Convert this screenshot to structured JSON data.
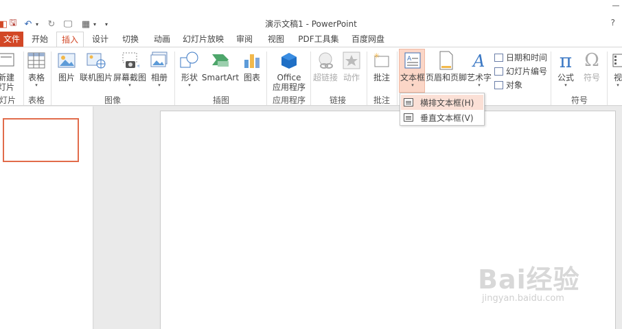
{
  "window": {
    "title": "演示文稿1 - PowerPoint",
    "help": "?"
  },
  "quick_access": {
    "save_icon": "save-icon",
    "undo_icon": "undo-icon",
    "undo_arrow": "▾",
    "redo_icon": "redo-icon",
    "customize_arrow": "▾"
  },
  "tabs": [
    "文件",
    "开始",
    "插入",
    "设计",
    "切换",
    "动画",
    "幻灯片放映",
    "审阅",
    "视图",
    "PDF工具集",
    "百度网盘"
  ],
  "active_tab": "插入",
  "ribbon": {
    "new_slide": {
      "line1": "新建",
      "line2": "灯片"
    },
    "table": "表格",
    "picture": "图片",
    "online_picture": "联机图片",
    "screenshot": "屏幕截图",
    "album": "相册",
    "shapes": "形状",
    "smartart": "SmartArt",
    "chart": "图表",
    "office_apps": {
      "line1": "Office",
      "line2": "应用程序"
    },
    "hyperlink": "超链接",
    "action": "动作",
    "comment": "批注",
    "textbox": "文本框",
    "header_footer": "页眉和页脚",
    "wordart": "艺术字",
    "date_time": "日期和时间",
    "slide_number": "幻灯片编号",
    "object": "对象",
    "equation": "公式",
    "symbol": "符号",
    "video": "视",
    "arrow": "▾"
  },
  "groups": {
    "slides": "灯片",
    "tables": "表格",
    "images": "图像",
    "illustrations": "插图",
    "apps": "应用程序",
    "links": "链接",
    "comments": "批注",
    "symbols": "符号"
  },
  "dropdown": {
    "horizontal": "横排文本框(H)",
    "vertical": "垂直文本框(V)"
  },
  "watermark": {
    "logo": "Bai经验",
    "url": "jingyan.baidu.com"
  },
  "colors": {
    "accent": "#d24726",
    "selection": "#fbe0d6",
    "thumb_border": "#e16b4a"
  }
}
